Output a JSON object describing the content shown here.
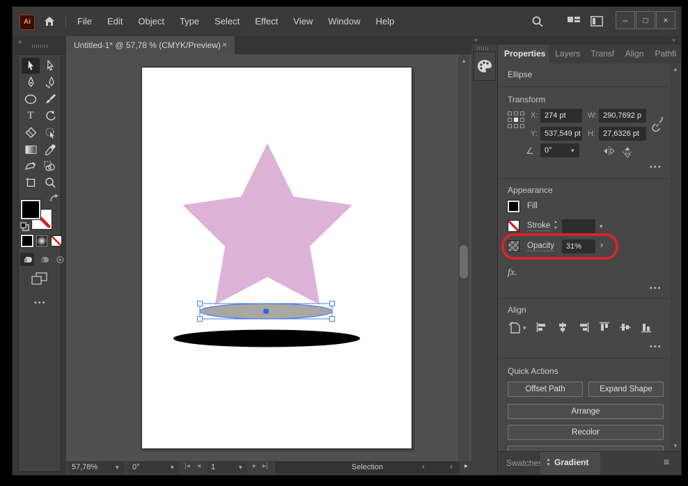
{
  "titlebar": {
    "logo": "Ai",
    "menus": [
      "File",
      "Edit",
      "Object",
      "Type",
      "Select",
      "Effect",
      "View",
      "Window",
      "Help"
    ],
    "window_controls": {
      "minimize": "–",
      "maximize": "□",
      "close": "×"
    }
  },
  "document_tab": {
    "title": "Untitled-1* @ 57,78 % (CMYK/Preview)",
    "close_glyph": "×"
  },
  "panel": {
    "tabs": [
      "Properties",
      "Layers",
      "Transf",
      "Align",
      "Pathfi"
    ],
    "object_type": "Ellipse",
    "transform": {
      "title": "Transform",
      "x_label": "X:",
      "x_value": "274 pt",
      "y_label": "Y:",
      "y_value": "537,549 pt",
      "w_label": "W:",
      "w_value": "290,7692 p",
      "h_label": "H:",
      "h_value": "27,6326 pt",
      "angle_value": "0°"
    },
    "appearance": {
      "title": "Appearance",
      "fill_label": "Fill",
      "stroke_label": "Stroke",
      "opacity_label": "Opacity",
      "opacity_value": "31%"
    },
    "fx_label": "fx",
    "align_title": "Align",
    "quick_actions": {
      "title": "Quick Actions",
      "offset_path": "Offset Path",
      "expand_shape": "Expand Shape",
      "arrange": "Arrange",
      "recolor": "Recolor"
    },
    "bottom_tabs": {
      "swatches": "Swatches",
      "gradient": "Gradient"
    }
  },
  "statusbar": {
    "zoom": "57,78%",
    "rotation": "0°",
    "artboard": "1",
    "tool": "Selection"
  },
  "colors": {
    "annotation_red": "#d2252b",
    "selection_blue": "#4a7de8",
    "star_pink": "#dcb3d6",
    "ellipse_gray": "#a9a7a3",
    "shadow_black": "#000000"
  }
}
